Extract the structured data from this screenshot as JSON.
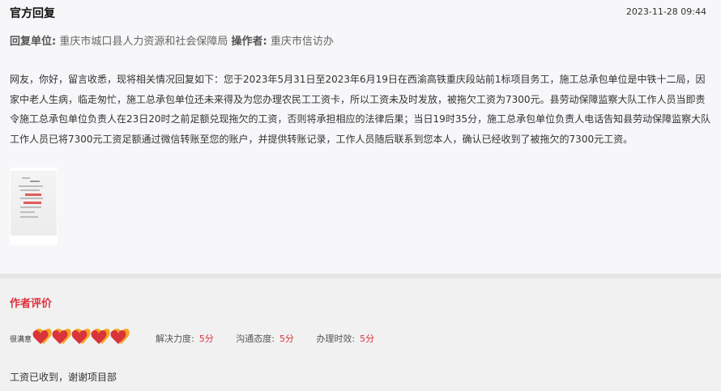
{
  "reply": {
    "title": "官方回复",
    "time": "2023-11-28 09:44",
    "unit_label": "回复单位:",
    "unit_value": "重庆市城口县人力资源和社会保障局",
    "operator_label": "操作者:",
    "operator_value": "重庆市信访办",
    "body": "网友，你好，留言收悉，现将相关情况回复如下：您于2023年5月31日至2023年6月19日在西渝高铁重庆段站前1标项目务工，施工总承包单位是中铁十二局，因家中老人生病，临走匆忙，施工总承包单位还未来得及为您办理农民工工资卡，所以工资未及时发放，被拖欠工资为7300元。县劳动保障监察大队工作人员当即责令施工总承包单位负责人在23日20时之前足额兑现拖欠的工资，否则将承担相应的法律后果；当日19时35分，施工总承包单位负责人电话告知县劳动保障监察大队工作人员已将7300元工资足额通过微信转账至您的账户，并提供转账记录，工作人员随后联系到您本人，确认已经收到了被拖欠的7300元工资。"
  },
  "review": {
    "title": "作者评价",
    "rating_label": "很满意",
    "rating": 5,
    "rating_max": 5,
    "scores": [
      {
        "label": "解决力度:",
        "value": "5分"
      },
      {
        "label": "沟通态度:",
        "value": "5分"
      },
      {
        "label": "办理时效:",
        "value": "5分"
      }
    ],
    "comment": "工资已收到，谢谢项目部"
  },
  "colors": {
    "accent": "#e0303a",
    "heart_red": "#d9343a",
    "heart_orange": "#f6a623"
  },
  "icons": {
    "heart": "heart-icon",
    "attachment": "document-thumbnail"
  }
}
